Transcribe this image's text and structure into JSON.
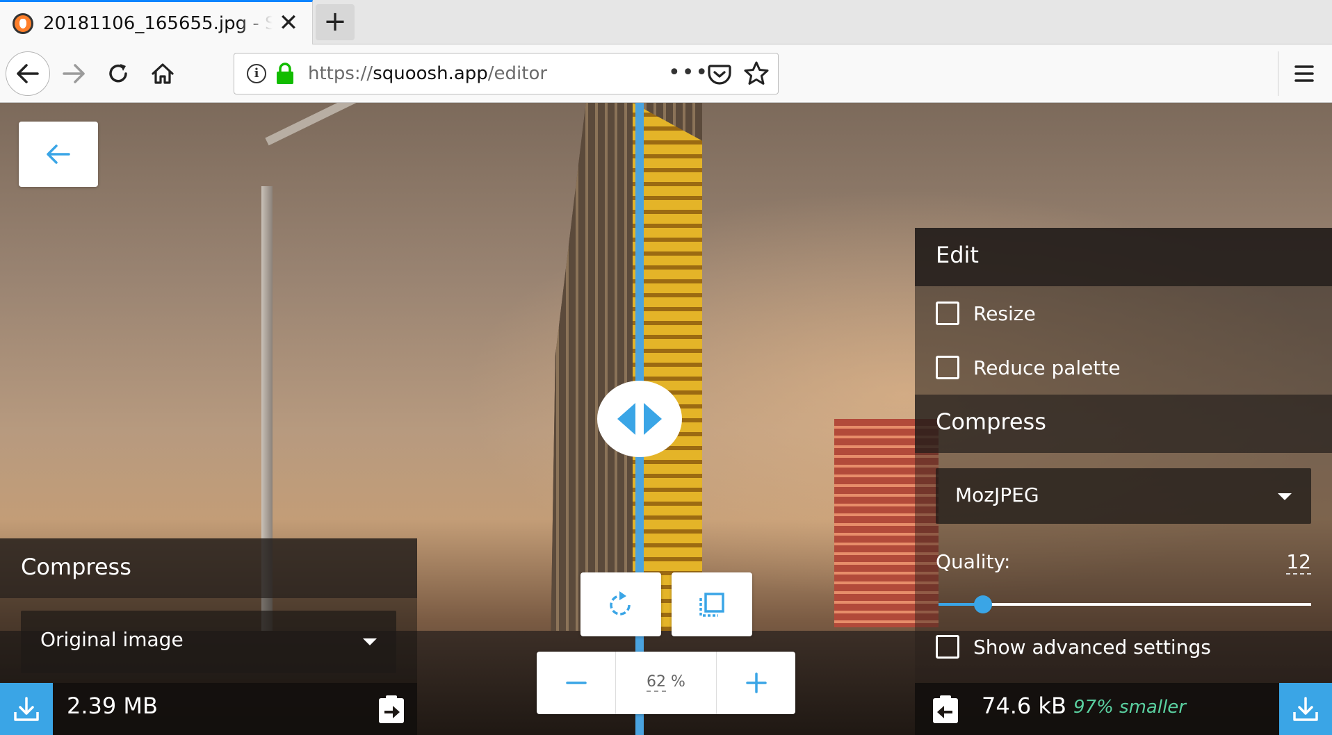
{
  "browser": {
    "tab_title": "20181106_165655.jpg - Squoosh",
    "tab_close": "✕",
    "new_tab": "+",
    "url_scheme": "https://",
    "url_host": "squoosh.app",
    "url_path": "/editor",
    "url_more": "•••",
    "accent": "#0a84ff",
    "secure_color": "#12bc00"
  },
  "editor": {
    "accent": "#3aa5e6",
    "zoom": {
      "value": "62",
      "unit": "%"
    },
    "divider_fraction": 0.48
  },
  "left_panel": {
    "title": "Compress",
    "format": "Original image",
    "size": "2.39 MB"
  },
  "right_panel": {
    "edit_title": "Edit",
    "resize_label": "Resize",
    "reduce_palette_label": "Reduce palette",
    "compress_title": "Compress",
    "format": "MozJPEG",
    "quality_label": "Quality:",
    "quality_value": "12",
    "quality_fraction": 0.12,
    "advanced_label": "Show advanced settings",
    "size": "74.6 kB",
    "savings": "97% smaller",
    "savings_color": "#5ad0a0"
  },
  "icons": {
    "favicon": "squoosh-logo-icon",
    "back": "arrow-left-icon",
    "forward": "arrow-right-icon",
    "reload": "reload-icon",
    "home": "home-icon",
    "info": "info-icon",
    "lock": "lock-icon",
    "pocket": "pocket-icon",
    "star": "star-icon",
    "menu": "hamburger-menu-icon",
    "rotate": "rotate-icon",
    "fit": "fit-screen-icon",
    "minus": "minus-icon",
    "plus": "plus-icon",
    "download": "download-icon",
    "copy": "copy-across-icon"
  }
}
